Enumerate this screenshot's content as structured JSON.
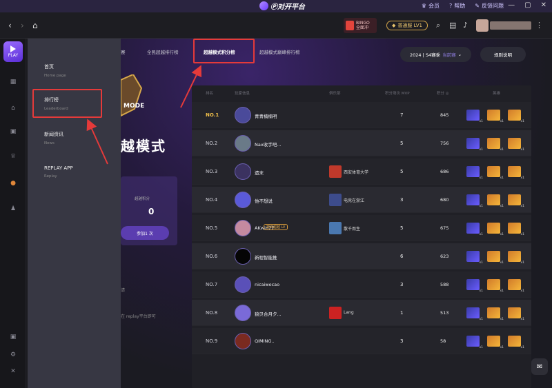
{
  "app": {
    "brand": "Ⓟ对开平台",
    "top_links": [
      {
        "icon": "crown-icon",
        "label": "会员"
      },
      {
        "icon": "help-icon",
        "label": "帮助"
      },
      {
        "icon": "feedback-icon",
        "label": "反馈问题"
      }
    ]
  },
  "navbar": {
    "vip_line1": "BINGO",
    "vip_line2": "全面冲",
    "level_badge": "普通服 LV1"
  },
  "sidebar": {
    "play_label": "PLAY"
  },
  "dropdown": {
    "items": [
      {
        "label": "首页",
        "sub": "Home page"
      },
      {
        "label": "排行榜",
        "sub": "Leaderboard"
      },
      {
        "label": "新闻资讯",
        "sub": "News"
      },
      {
        "label": "REPLAY APP",
        "sub": "Replay"
      }
    ]
  },
  "tabs": [
    {
      "label": "赛",
      "active": false
    },
    {
      "label": "全民超越排行榜",
      "active": false
    },
    {
      "label": "超越模式积分榜",
      "active": true
    },
    {
      "label": "超越模式巅峰排行榜",
      "active": false
    }
  ],
  "season": {
    "label": "2024 | S4赛季",
    "sub": "当前赛"
  },
  "rules_label": "规则说明",
  "mode": {
    "logo_text": "MODE",
    "title": "越模式",
    "stats_label": "超越积分",
    "stats_value": "0",
    "pill_label": "参加1 次",
    "note": "在 replay平台即可",
    "note2": "请"
  },
  "leaderboard": {
    "headers": [
      "排名",
      "玩家信息",
      "俱乐部",
      "积分场次 MVP",
      "积分 ◎",
      "英雄"
    ],
    "rows": [
      {
        "rank": "NO.1",
        "name": "青青楠楠明",
        "club": "",
        "mvp": "7",
        "score": "845",
        "avatar": "#4a4a9a",
        "club_color": ""
      },
      {
        "rank": "NO.2",
        "name": "Nax收手吧...",
        "club": "",
        "mvp": "5",
        "score": "756",
        "avatar": "#6a7a88",
        "club_color": ""
      },
      {
        "rank": "NO.3",
        "name": "遗末",
        "club": "西安体育大学",
        "mvp": "5",
        "score": "686",
        "avatar": "#3b3260",
        "club_color": "#c0392b"
      },
      {
        "rank": "NO.4",
        "name": "他不想说",
        "club": "电竞在浙江",
        "mvp": "3",
        "score": "680",
        "avatar": "#5a5ad8",
        "club_color": "#3d4c8c"
      },
      {
        "rank": "NO.5",
        "name": "AKwin77",
        "club": "散千而生",
        "mvp": "5",
        "score": "675",
        "avatar": "#c48aa0",
        "club_color": "#4a78b0",
        "tag": "巅峰超越 LV"
      },
      {
        "rank": "NO.6",
        "name": "新程智能推",
        "club": "",
        "mvp": "6",
        "score": "623",
        "avatar": "#050505",
        "club_color": ""
      },
      {
        "rank": "NO.7",
        "name": "nicaiwocao",
        "club": "",
        "mvp": "3",
        "score": "588",
        "avatar": "#5a50b8",
        "club_color": ""
      },
      {
        "rank": "NO.8",
        "name": "狼贝合月夕...",
        "club": "Lang",
        "mvp": "1",
        "score": "513",
        "avatar": "#7a6ad8",
        "club_color": "#c22"
      },
      {
        "rank": "NO.9",
        "name": "QIMING..",
        "club": "",
        "mvp": "3",
        "score": "58",
        "avatar": "#7a2a20",
        "club_color": ""
      }
    ],
    "hero_counts": [
      "x1",
      "x1",
      "x1"
    ]
  },
  "colors": {
    "accent": "#7c4dff",
    "highlight": "#e53a3a",
    "gold": "#f2c14a"
  }
}
